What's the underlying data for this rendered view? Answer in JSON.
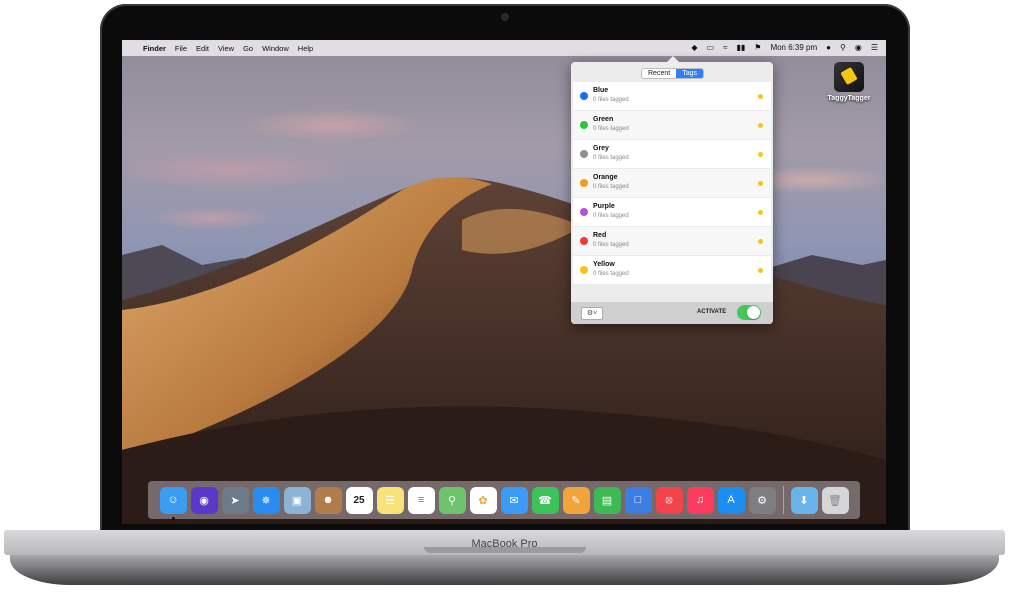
{
  "menubar": {
    "app_name": "Finder",
    "items": [
      "File",
      "Edit",
      "View",
      "Go",
      "Window",
      "Help"
    ],
    "clock": "Mon 6:39 pm"
  },
  "desktop": {
    "icon_label": "TaggyTagger"
  },
  "popover": {
    "tabs": [
      {
        "label": "Recent",
        "active": false
      },
      {
        "label": "Tags",
        "active": true
      }
    ],
    "tags": [
      {
        "name": "Blue",
        "count": "0 files tagged",
        "color": "#1a6bf2"
      },
      {
        "name": "Green",
        "count": "0 files tagged",
        "color": "#2dc540"
      },
      {
        "name": "Grey",
        "count": "0 files tagged",
        "color": "#8e8e93"
      },
      {
        "name": "Orange",
        "count": "0 files tagged",
        "color": "#f59a1b"
      },
      {
        "name": "Purple",
        "count": "0 files tagged",
        "color": "#b152e0"
      },
      {
        "name": "Red",
        "count": "0 files tagged",
        "color": "#f03a31"
      },
      {
        "name": "Yellow",
        "count": "0 files tagged",
        "color": "#f7c519"
      }
    ],
    "status_color": "#f5c518",
    "activate_label": "ACTIVATE",
    "activate_on": true
  },
  "dock": {
    "apps": [
      {
        "icon": "finder-icon",
        "color": "#3c9cf0"
      },
      {
        "icon": "siri-icon",
        "color": "#5b38c9"
      },
      {
        "icon": "launchpad-icon",
        "color": "#6c7a89"
      },
      {
        "icon": "safari-icon",
        "color": "#2b8cf0"
      },
      {
        "icon": "preview-icon",
        "color": "#8bb3d6"
      },
      {
        "icon": "contacts-icon",
        "color": "#b07c4a"
      },
      {
        "icon": "calendar-icon",
        "color": "#ffffff"
      },
      {
        "icon": "notes-icon",
        "color": "#f7e37a"
      },
      {
        "icon": "reminders-icon",
        "color": "#ffffff"
      },
      {
        "icon": "maps-icon",
        "color": "#6fc36a"
      },
      {
        "icon": "photos-icon",
        "color": "#ffffff"
      },
      {
        "icon": "messages-icon",
        "color": "#3b9bf5"
      },
      {
        "icon": "facetime-icon",
        "color": "#3dc35a"
      },
      {
        "icon": "pages-icon",
        "color": "#f2a33a"
      },
      {
        "icon": "numbers-icon",
        "color": "#3dbb52"
      },
      {
        "icon": "keynote-icon",
        "color": "#3b7de0"
      },
      {
        "icon": "news-icon",
        "color": "#f2454b"
      },
      {
        "icon": "music-icon",
        "color": "#fc3c5d"
      },
      {
        "icon": "app-store-icon",
        "color": "#1b8ef2"
      },
      {
        "icon": "system-preferences-icon",
        "color": "#7d7d82"
      },
      {
        "icon": "downloads-folder-icon",
        "color": "#69b4e8"
      },
      {
        "icon": "trash-icon",
        "color": "#d6d6d9"
      }
    ],
    "calendar_day": "25"
  },
  "device": {
    "label": "MacBook Pro"
  }
}
